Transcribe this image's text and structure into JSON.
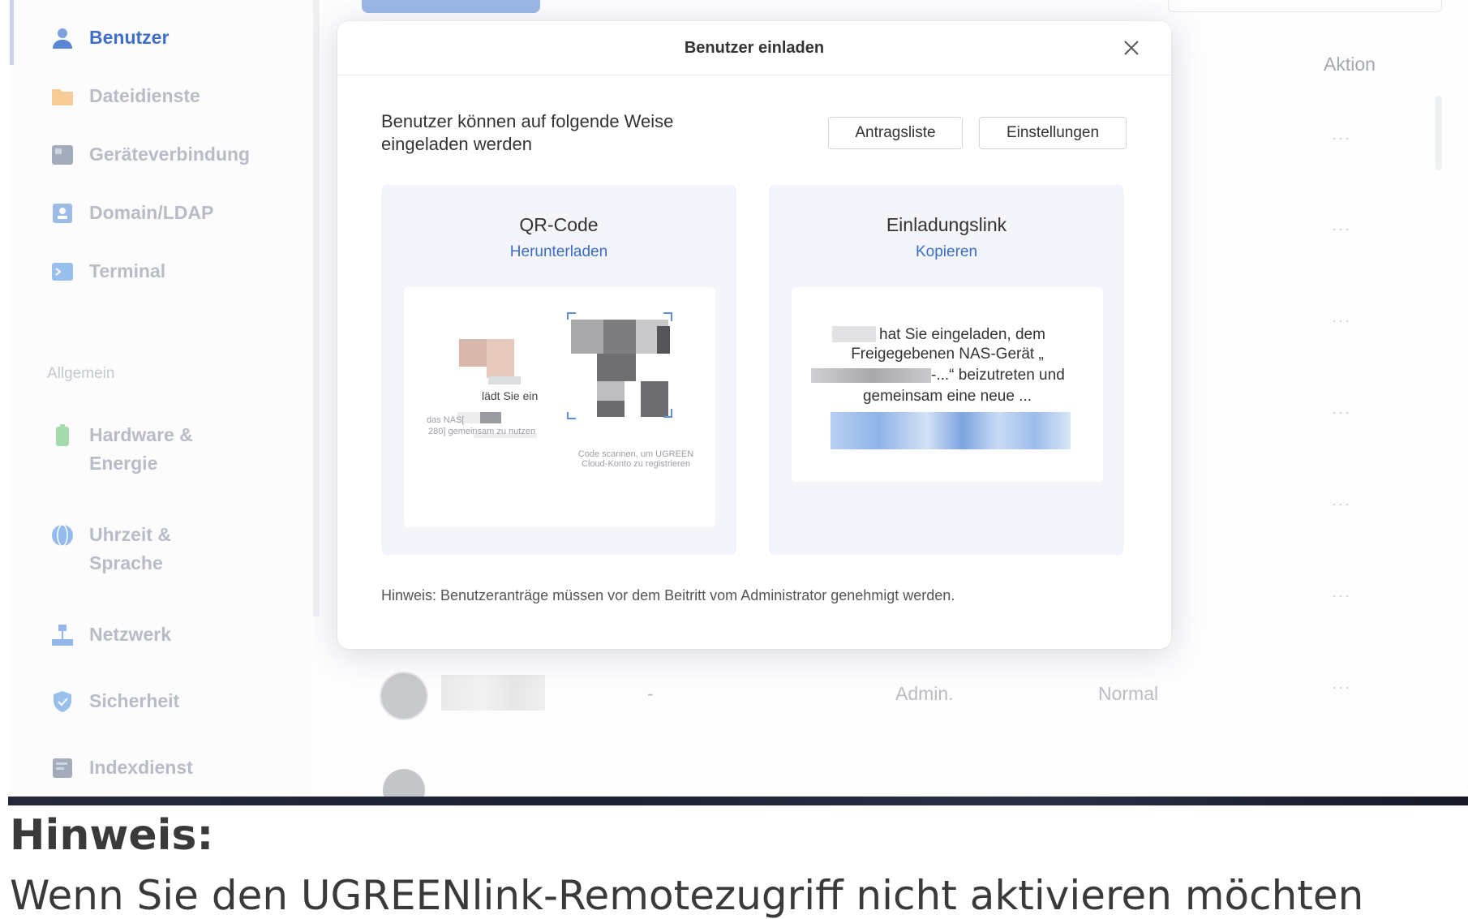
{
  "sidebar": {
    "items": [
      {
        "label": "Benutzer",
        "icon": "user-icon",
        "active": true
      },
      {
        "label": "Dateidienste",
        "icon": "folder-icon"
      },
      {
        "label": "Geräteverbindung",
        "icon": "device-icon"
      },
      {
        "label": "Domain/LDAP",
        "icon": "domain-icon"
      },
      {
        "label": "Terminal",
        "icon": "terminal-icon"
      }
    ],
    "section": "Allgemein",
    "general_items": [
      {
        "label": "Hardware &",
        "label2": "Energie",
        "icon": "hardware-icon"
      },
      {
        "label": "Uhrzeit &",
        "label2": "Sprache",
        "icon": "globe-icon"
      },
      {
        "label": "Netzwerk",
        "icon": "network-icon"
      },
      {
        "label": "Sicherheit",
        "icon": "shield-icon"
      },
      {
        "label": "Indexdienst",
        "icon": "index-icon"
      }
    ]
  },
  "table": {
    "action_header": "Aktion",
    "row_actions": "···",
    "visible_row": {
      "cell1": "-",
      "role": "Admin.",
      "status": "Normal"
    }
  },
  "modal": {
    "title": "Benutzer einladen",
    "intro": "Benutzer können auf folgende Weise eingeladen werden",
    "buttons": {
      "requests": "Antragsliste",
      "settings": "Einstellungen"
    },
    "qr_card": {
      "title": "QR-Code",
      "action": "Herunterladen",
      "invite_text": "lädt Sie ein",
      "share_text": "das NAS[",
      "share_text2": "280] gemeinsam zu nutzen",
      "scan_text": "Code scannen, um UGREEN Cloud-Konto zu registrieren"
    },
    "link_card": {
      "title": "Einladungslink",
      "action": "Kopieren",
      "line1": "hat Sie eingeladen, dem",
      "line2": "Freigegebenen NAS-Gerät „",
      "line3": "-...“ beizutreten und",
      "line4": "gemeinsam eine neue ..."
    },
    "note": "Hinweis: Benutzeranträge müssen vor dem Beitritt vom Administrator genehmigt werden."
  },
  "page": {
    "heading": "Hinweis:",
    "text": "Wenn Sie den UGREENlink-Remotezugriff nicht aktivieren möchten"
  }
}
